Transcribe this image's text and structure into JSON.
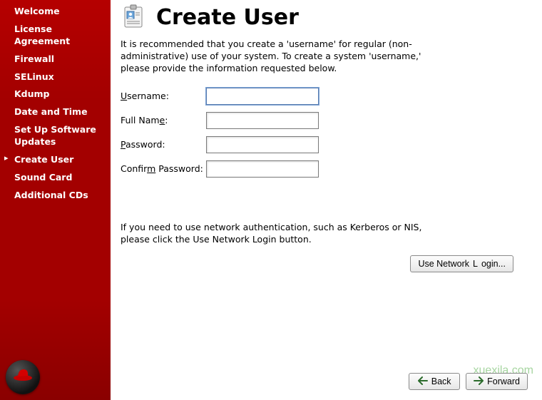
{
  "sidebar": {
    "items": [
      {
        "label": "Welcome"
      },
      {
        "label": "License Agreement"
      },
      {
        "label": "Firewall"
      },
      {
        "label": "SELinux"
      },
      {
        "label": "Kdump"
      },
      {
        "label": "Date and Time"
      },
      {
        "label": "Set Up Software Updates"
      },
      {
        "label": "Create User"
      },
      {
        "label": "Sound Card"
      },
      {
        "label": "Additional CDs"
      }
    ],
    "current_index": 7
  },
  "page": {
    "title": "Create User",
    "description": "It is recommended that you create a 'username' for regular (non-administrative) use of your system. To create a system 'username,' please provide the information requested below."
  },
  "form": {
    "username": {
      "label_pre": "U",
      "label_post": "sername:",
      "value": ""
    },
    "fullname": {
      "label_pre": "Full Nam",
      "label_u": "e",
      "label_post": ":",
      "value": ""
    },
    "password": {
      "label_pre": "P",
      "label_post": "assword:",
      "value": ""
    },
    "confirm": {
      "label_pre": "Confir",
      "label_u": "m",
      "label_post": " Password:",
      "value": ""
    }
  },
  "network": {
    "text": "If you need to use network authentication, such as Kerberos or NIS, please click the Use Network Login button.",
    "button_pre": "Use Network ",
    "button_u": "L",
    "button_post": "ogin..."
  },
  "nav": {
    "back_u": "B",
    "back_post": "ack",
    "forward_u": "F",
    "forward_post": "orward"
  },
  "watermark": "xuexila.com"
}
